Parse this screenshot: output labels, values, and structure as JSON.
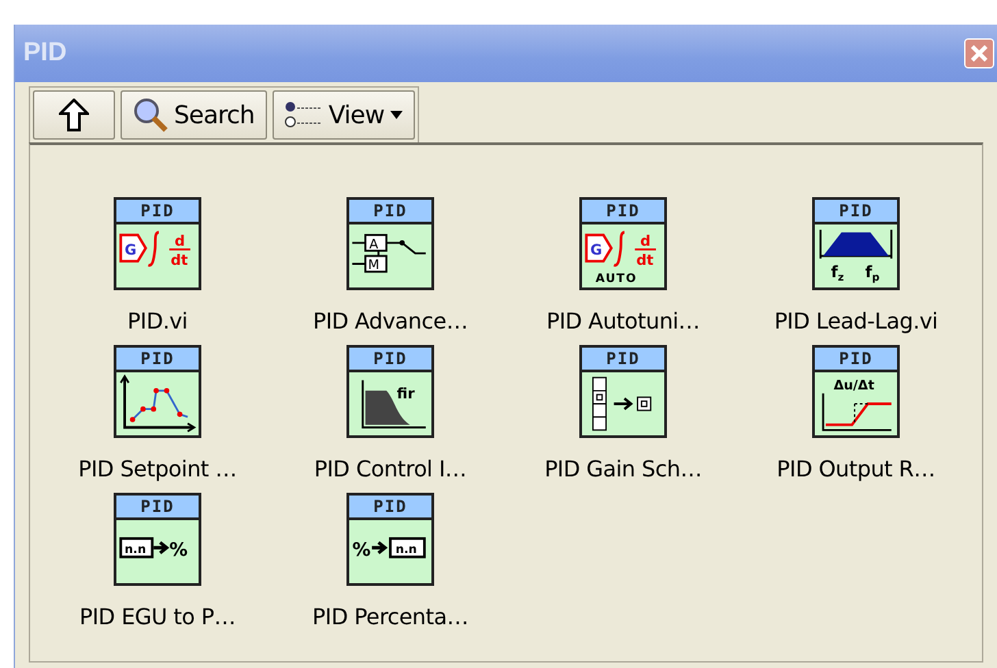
{
  "window": {
    "title": "PID"
  },
  "toolbar": {
    "buttons": [
      {
        "kind": "up"
      },
      {
        "kind": "search",
        "label": "Search"
      },
      {
        "kind": "view",
        "label": "View"
      }
    ]
  },
  "items": [
    {
      "label": "PID.vi",
      "kind": "pid",
      "header": "PID",
      "glyphs": [
        "G",
        "d",
        "dt"
      ]
    },
    {
      "label": "PID Advance…",
      "kind": "advanced",
      "header": "PID",
      "glyphs": [
        "A",
        "M"
      ]
    },
    {
      "label": "PID Autotuni…",
      "kind": "autotune",
      "header": "PID",
      "glyphs": [
        "G",
        "d",
        "dt",
        "AUTO"
      ]
    },
    {
      "label": "PID Lead-Lag.vi",
      "kind": "leadlag",
      "header": "PID",
      "glyphs": [
        "f$_{z}$",
        "f$_{p}$"
      ]
    },
    {
      "label": "PID Setpoint …",
      "kind": "setpoint",
      "header": "PID"
    },
    {
      "label": "PID Control I…",
      "kind": "filter",
      "header": "PID",
      "glyphs": [
        "fir"
      ]
    },
    {
      "label": "PID Gain Sch…",
      "kind": "gain",
      "header": "PID"
    },
    {
      "label": "PID Output R…",
      "kind": "ramp",
      "header": "PID",
      "glyphs": [
        "Δu/Δt"
      ]
    },
    {
      "label": "PID EGU to P…",
      "kind": "egu",
      "header": "PID",
      "glyphs": [
        "n.n",
        "%"
      ]
    },
    {
      "label": "PID Percenta…",
      "kind": "percent",
      "header": "PID",
      "glyphs": [
        "%",
        "n.n"
      ]
    }
  ]
}
